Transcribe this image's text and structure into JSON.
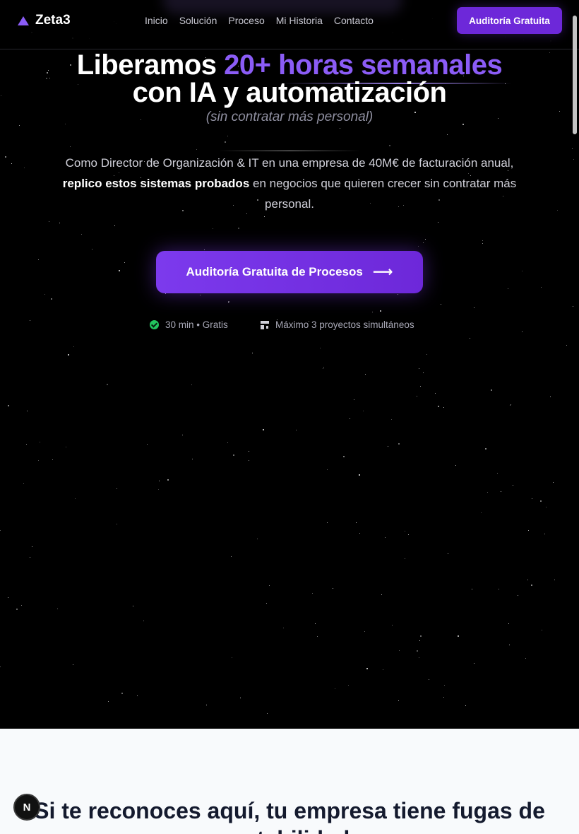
{
  "nav": {
    "brand": "Zeta3",
    "links": [
      "Inicio",
      "Solución",
      "Proceso",
      "Mi Historia",
      "Contacto"
    ],
    "cta_label": "Auditoría Gratuita"
  },
  "hero": {
    "headline_part1": "Liberamos",
    "headline_accent": "20+ horas semanales",
    "headline_line2": "con IA y automatización",
    "subheadline": "(sin contratar más personal)",
    "description_line1": "Como Director de Organización & IT en una empresa de 40M€ de facturación anual,",
    "description_strong": "replico estos sistemas probados",
    "description_rest": " en negocios que quieren crecer sin contratar más personal.",
    "cta_label": "Auditoría Gratuita de Procesos",
    "meta": [
      {
        "icon": "check-circle-icon",
        "text": "30 min • Gratis"
      },
      {
        "icon": "building-icon",
        "text": "Máximo 3 proyectos simultáneos"
      }
    ]
  },
  "section2": {
    "title": "Si te reconoces aquí, tu empresa tiene fugas de rentabilidad:"
  },
  "badge": {
    "label": "N"
  },
  "colors": {
    "accent": "#8b5cf6",
    "button": "#6d28d9",
    "hero_bg": "#000000",
    "section_bg": "#f8fafc",
    "heading_dark": "#141a2e"
  }
}
